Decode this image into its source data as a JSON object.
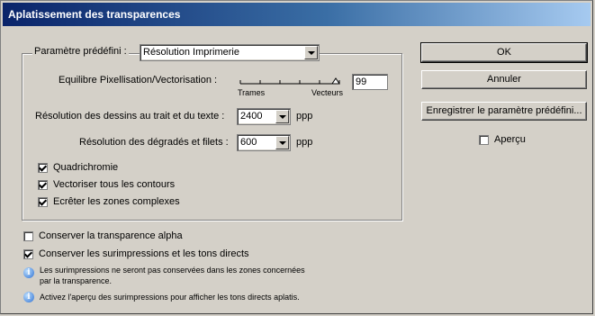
{
  "window": {
    "title": "Aplatissement des transparences"
  },
  "preset": {
    "label": "Paramètre prédéfini :",
    "value": "Résolution Imprimerie"
  },
  "balance": {
    "label": "Equilibre Pixellisation/Vectorisation :",
    "left_label": "Trames",
    "right_label": "Vecteurs",
    "value": "99"
  },
  "line_art": {
    "label": "Résolution des dessins au trait et du texte :",
    "value": "2400",
    "unit": "ppp"
  },
  "gradient": {
    "label": "Résolution des dégradés et filets :",
    "value": "600",
    "unit": "ppp"
  },
  "options": [
    {
      "label": "Quadrichromie",
      "checked": true
    },
    {
      "label": "Vectoriser tous les contours",
      "checked": true
    },
    {
      "label": "Ecrêter les zones complexes",
      "checked": true
    }
  ],
  "outer_options": [
    {
      "label": "Conserver la transparence alpha",
      "checked": false
    },
    {
      "label": "Conserver les surimpressions et les tons directs",
      "checked": true
    }
  ],
  "notes": [
    {
      "line1": "Les surimpressions ne seront pas conservées dans les zones concernées",
      "line2": "par la transparence."
    },
    {
      "line1": "Activez l'aperçu des surimpressions pour afficher les tons directs aplatis."
    }
  ],
  "buttons": {
    "ok": "OK",
    "cancel": "Annuler",
    "save_preset": "Enregistrer le paramètre prédéfini..."
  },
  "preview": {
    "label": "Aperçu",
    "checked": false
  },
  "icons": {
    "info": "i"
  }
}
